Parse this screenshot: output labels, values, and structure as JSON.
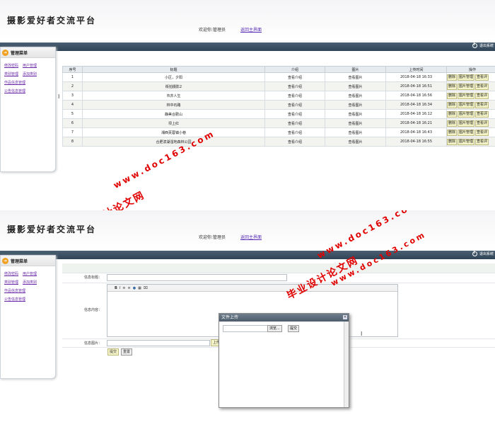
{
  "header": {
    "title": "摄影爱好者交流平台",
    "welcome": "欢迎你:管理员",
    "home_link": "返回主界面",
    "logout": "退出系统"
  },
  "sidebar": {
    "title": "管理菜单",
    "links": [
      [
        "修改密码",
        "用户管理"
      ],
      [
        "类别管理",
        "添加类别"
      ],
      [
        "作品信息管理"
      ],
      [
        "公告信息管理"
      ]
    ]
  },
  "table": {
    "headers": [
      "序号",
      "标题",
      "介绍",
      "图片",
      "上传时间",
      "操作"
    ],
    "rows": [
      {
        "no": "1",
        "title": "小区，夕阳",
        "intro": "查看介绍",
        "pic": "查看图片",
        "time": "2018-04-18 16:33"
      },
      {
        "no": "2",
        "title": "街拍摄影2",
        "intro": "查看介绍",
        "pic": "查看图片",
        "time": "2018-04-18 16:51"
      },
      {
        "no": "3",
        "title": "市井人生",
        "intro": "查看介绍",
        "pic": "查看图片",
        "time": "2018-04-18 16:56"
      },
      {
        "no": "4",
        "title": "林中石路",
        "intro": "查看介绍",
        "pic": "查看图片",
        "time": "2018-04-18 16:34"
      },
      {
        "no": "5",
        "title": "静美合歡山",
        "intro": "查看介绍",
        "pic": "查看图片",
        "time": "2018-04-18 16:12"
      },
      {
        "no": "6",
        "title": "坝上红",
        "intro": "查看介绍",
        "pic": "查看图片",
        "time": "2018-04-18 16:21"
      },
      {
        "no": "7",
        "title": "湘西芙蓉镇小巷",
        "intro": "查看介绍",
        "pic": "查看图片",
        "time": "2018-04-18 16:43"
      },
      {
        "no": "8",
        "title": "合肥滨湖湿地森林公园",
        "intro": "查看介绍",
        "pic": "查看图片",
        "time": "2018-04-18 16:55"
      }
    ],
    "ops": [
      "删除",
      "图片管理",
      "查看评"
    ]
  },
  "form": {
    "title_label": "信息标题：",
    "content_label": "信息内容：",
    "image_label": "信息图片：",
    "upload_btn": "上传",
    "submit": "提交",
    "reset": "重置",
    "toolbar": [
      "B",
      "I",
      "≡",
      "≡",
      "●",
      "▦",
      "⌧"
    ]
  },
  "dialog": {
    "title": "文件上传",
    "browse": "浏览...",
    "submit": "提交"
  },
  "watermark": {
    "site": "www.doc163.com",
    "brand": "毕业设计论文网"
  },
  "colors": {
    "bar": "#3a5062",
    "link": "#6a2aa8",
    "watermark": "#e00000"
  }
}
